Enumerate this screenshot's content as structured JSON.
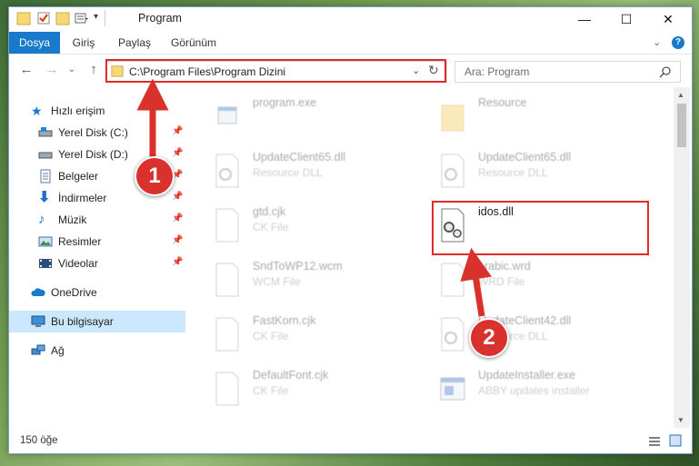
{
  "window": {
    "title": "Program",
    "controls": {
      "minimize": "—",
      "maximize": "☐",
      "close": "✕"
    }
  },
  "ribbon": {
    "tabs": [
      {
        "label": "Dosya",
        "active": true
      },
      {
        "label": "Giriş"
      },
      {
        "label": "Paylaş"
      },
      {
        "label": "Görünüm"
      }
    ]
  },
  "address": {
    "path": "C:\\Program Files\\Program Dizini"
  },
  "search": {
    "placeholder": "Ara: Program"
  },
  "nav_pane": {
    "items": [
      {
        "label": "Hızlı erişim",
        "icon": "star-icon",
        "pinned": false
      },
      {
        "label": "Yerel Disk (C:)",
        "icon": "drive-icon",
        "pinned": true
      },
      {
        "label": "Yerel Disk (D:)",
        "icon": "drive-icon",
        "pinned": true
      },
      {
        "label": "Belgeler",
        "icon": "documents-icon",
        "pinned": true
      },
      {
        "label": "İndirmeler",
        "icon": "download-icon",
        "pinned": true
      },
      {
        "label": "Müzik",
        "icon": "music-icon",
        "pinned": true
      },
      {
        "label": "Resimler",
        "icon": "pictures-icon",
        "pinned": true
      },
      {
        "label": "Videolar",
        "icon": "videos-icon",
        "pinned": true
      },
      {
        "label": "OneDrive",
        "icon": "cloud-icon",
        "pinned": false
      },
      {
        "label": "Bu bilgisayar",
        "icon": "computer-icon",
        "pinned": false,
        "selected": true
      },
      {
        "label": "Ağ",
        "icon": "network-icon",
        "pinned": false
      }
    ]
  },
  "files": [
    {
      "name": "program.exe",
      "type": "",
      "icon": "exe-icon"
    },
    {
      "name": "Resource",
      "type": "",
      "icon": "folder-icon"
    },
    {
      "name": "UpdateClient65.dll",
      "type": "Resource DLL",
      "icon": "dll-icon"
    },
    {
      "name": "UpdateClient65.dll",
      "type": "Resource DLL",
      "icon": "dll-icon"
    },
    {
      "name": "gtd.cjk",
      "type": "CK File",
      "icon": "file-icon"
    },
    {
      "name": "idos.dll",
      "type": "",
      "icon": "dll-icon",
      "highlighted": true
    },
    {
      "name": "SndToWP12.wcm",
      "type": "WCM File",
      "icon": "file-icon"
    },
    {
      "name": "arabic.wrd",
      "type": "WRD File",
      "icon": "file-icon"
    },
    {
      "name": "FastKorn.cjk",
      "type": "CK File",
      "icon": "file-icon"
    },
    {
      "name": "UpdateClient42.dll",
      "type": "Resource DLL",
      "icon": "dll-icon"
    },
    {
      "name": "DefaultFont.cjk",
      "type": "CK File",
      "icon": "file-icon"
    },
    {
      "name": "UpdateInstaller.exe",
      "type": "ABBY updates installer",
      "icon": "installer-icon"
    }
  ],
  "status": {
    "count": "150 öğe"
  },
  "annotations": {
    "step1": "1",
    "step2": "2",
    "color": "#d9322c"
  }
}
